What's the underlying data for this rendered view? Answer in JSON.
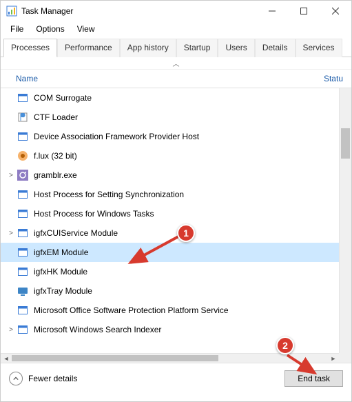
{
  "window": {
    "title": "Task Manager"
  },
  "menu": {
    "file": "File",
    "options": "Options",
    "view": "View"
  },
  "tabs": {
    "processes": "Processes",
    "performance": "Performance",
    "app_history": "App history",
    "startup": "Startup",
    "users": "Users",
    "details": "Details",
    "services": "Services"
  },
  "columns": {
    "name": "Name",
    "status": "Statu"
  },
  "processes": [
    {
      "label": "COM Surrogate",
      "icon": "exe",
      "expandable": false,
      "selected": false
    },
    {
      "label": "CTF Loader",
      "icon": "ctf",
      "expandable": false,
      "selected": false
    },
    {
      "label": "Device Association Framework Provider Host",
      "icon": "exe",
      "expandable": false,
      "selected": false
    },
    {
      "label": "f.lux (32 bit)",
      "icon": "flux",
      "expandable": false,
      "selected": false
    },
    {
      "label": "gramblr.exe",
      "icon": "gramblr",
      "expandable": true,
      "selected": false
    },
    {
      "label": "Host Process for Setting Synchronization",
      "icon": "exe",
      "expandable": false,
      "selected": false
    },
    {
      "label": "Host Process for Windows Tasks",
      "icon": "exe",
      "expandable": false,
      "selected": false
    },
    {
      "label": "igfxCUIService Module",
      "icon": "exe",
      "expandable": true,
      "selected": false
    },
    {
      "label": "igfxEM Module",
      "icon": "exe",
      "expandable": false,
      "selected": true
    },
    {
      "label": "igfxHK Module",
      "icon": "exe",
      "expandable": false,
      "selected": false
    },
    {
      "label": "igfxTray Module",
      "icon": "igfxtray",
      "expandable": false,
      "selected": false
    },
    {
      "label": "Microsoft Office Software Protection Platform Service",
      "icon": "exe",
      "expandable": false,
      "selected": false
    },
    {
      "label": "Microsoft Windows Search Indexer",
      "icon": "exe",
      "expandable": true,
      "selected": false
    }
  ],
  "bottom": {
    "fewer_details": "Fewer details",
    "end_task": "End task"
  },
  "annotations": {
    "marker1": "1",
    "marker2": "2"
  }
}
